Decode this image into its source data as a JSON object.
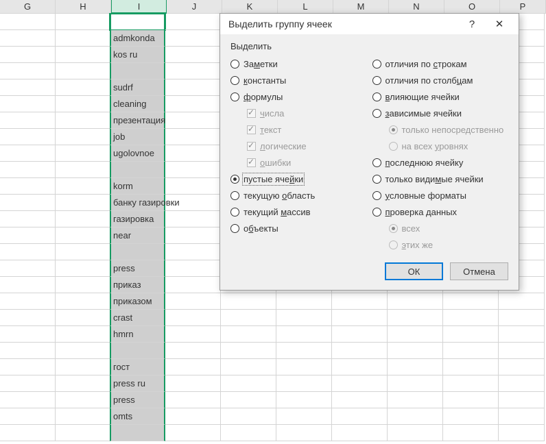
{
  "columns": [
    "G",
    "H",
    "I",
    "J",
    "K",
    "L",
    "M",
    "N",
    "O",
    "P"
  ],
  "selected_column": "I",
  "cell_values": {
    "2": "admkonda",
    "3": "kos ru",
    "5": "sudrf",
    "6": "cleaning",
    "7": "презентация",
    "8": "job",
    "9": "ugolovnoe",
    "11": "korm",
    "12": "банку газировки",
    "13": "газировка",
    "14": "near",
    "16": "press",
    "17": "приказ",
    "18": "приказом",
    "19": "crast",
    "20": "hmrn",
    "22": "гост",
    "23": "press ru",
    "24": "press",
    "25": "omts"
  },
  "row_count": 26,
  "dialog": {
    "title": "Выделить группу ячеек",
    "help": "?",
    "close": "✕",
    "group_label": "Выделить",
    "left_options": [
      {
        "type": "radio",
        "label": "Заметки",
        "key": "м",
        "checked": false
      },
      {
        "type": "radio",
        "label": "константы",
        "key": "к",
        "checked": false
      },
      {
        "type": "radio",
        "label": "формулы",
        "key": "ф",
        "checked": false
      },
      {
        "type": "check",
        "label": "числа",
        "key": "ч",
        "indent": true,
        "checked": true,
        "disabled": true
      },
      {
        "type": "check",
        "label": "текст",
        "key": "т",
        "indent": true,
        "checked": true,
        "disabled": true
      },
      {
        "type": "check",
        "label": "логические",
        "key": "л",
        "indent": true,
        "checked": true,
        "disabled": true
      },
      {
        "type": "check",
        "label": "ошибки",
        "key": "о",
        "indent": true,
        "checked": true,
        "disabled": true
      },
      {
        "type": "radio",
        "label": "пустые ячейки",
        "key": "й",
        "checked": true,
        "focused": true
      },
      {
        "type": "radio",
        "label": "текущую область",
        "key": "о",
        "checked": false
      },
      {
        "type": "radio",
        "label": "текущий массив",
        "key": "м",
        "checked": false
      },
      {
        "type": "radio",
        "label": "объекты",
        "key": "б",
        "checked": false
      }
    ],
    "right_options": [
      {
        "type": "radio",
        "label": "отличия по строкам",
        "key": "с",
        "checked": false
      },
      {
        "type": "radio",
        "label": "отличия по столбцам",
        "key": "ц",
        "checked": false
      },
      {
        "type": "radio",
        "label": "влияющие ячейки",
        "key": "в",
        "checked": false
      },
      {
        "type": "radio",
        "label": "зависимые ячейки",
        "key": "з",
        "checked": false
      },
      {
        "type": "radio",
        "label": "только непосредственно",
        "indent": true,
        "checked": true,
        "disabled": true
      },
      {
        "type": "radio",
        "label": "на всех уровнях",
        "key": "у",
        "indent": true,
        "checked": false,
        "disabled": true
      },
      {
        "type": "radio",
        "label": "последнюю ячейку",
        "key": "п",
        "checked": false
      },
      {
        "type": "radio",
        "label": "только видимые ячейки",
        "key": "м",
        "checked": false
      },
      {
        "type": "radio",
        "label": "условные форматы",
        "key": "у",
        "checked": false
      },
      {
        "type": "radio",
        "label": "проверка данных",
        "key": "п",
        "checked": false
      },
      {
        "type": "radio",
        "label": "всех",
        "indent": true,
        "checked": true,
        "disabled": true
      },
      {
        "type": "radio",
        "label": "этих же",
        "key": "э",
        "indent": true,
        "checked": false,
        "disabled": true
      }
    ],
    "ok_label": "ОК",
    "cancel_label": "Отмена"
  }
}
